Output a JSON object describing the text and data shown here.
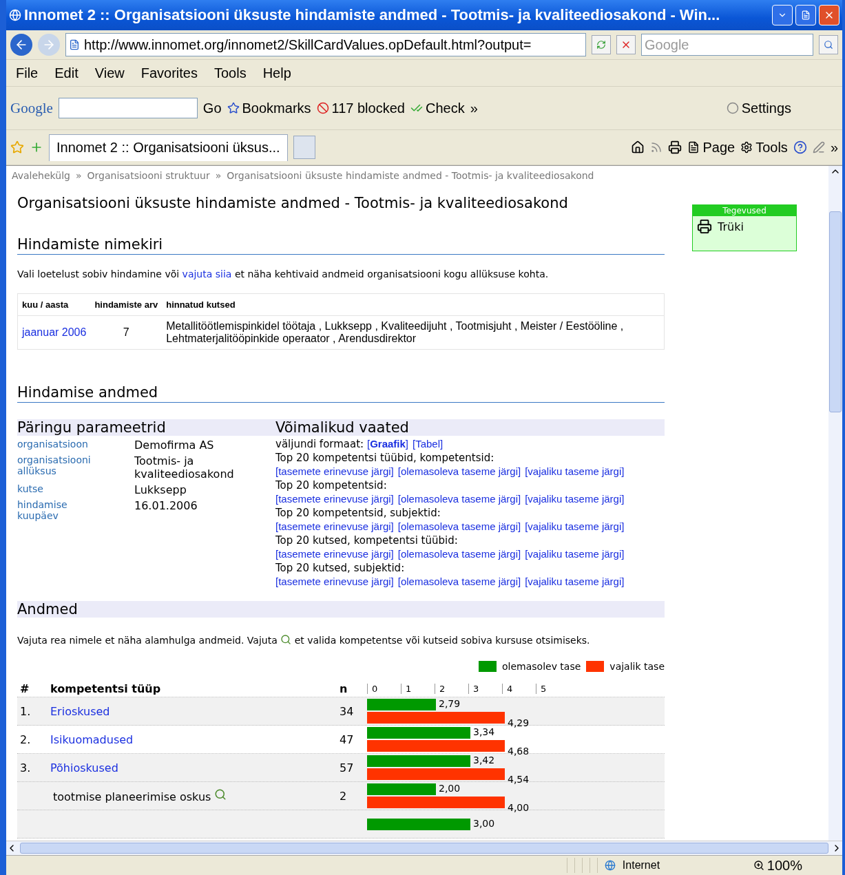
{
  "window": {
    "title": "Innomet 2 :: Organisatsiooni üksuste hindamiste andmed - Tootmis- ja kvaliteediosakond - Win..."
  },
  "address_bar": {
    "url": "http://www.innomet.org/innomet2/SkillCardValues.opDefault.html?output=",
    "search_placeholder": "Google"
  },
  "menu": [
    "File",
    "Edit",
    "View",
    "Favorites",
    "Tools",
    "Help"
  ],
  "google_toolbar": {
    "logo": "Google",
    "go": "Go",
    "bookmarks": "Bookmarks",
    "blocked": "117 blocked",
    "check": "Check",
    "more": "»",
    "settings": "Settings"
  },
  "tabs": [
    {
      "label": "Innomet 2 :: Organisatsiooni üksus...",
      "selected": true
    }
  ],
  "command_bar": {
    "page": "Page",
    "tools": "Tools",
    "more": "»"
  },
  "breadcrumb": {
    "separator": "»",
    "items": [
      "Avalehekülg",
      "Organisatsiooni struktuur",
      "Organisatsiooni üksuste hindamiste andmed - Tootmis- ja kvaliteediosakond"
    ]
  },
  "heading": "Organisatsiooni üksuste hindamiste andmed - Tootmis- ja kvaliteediosakond",
  "actions": {
    "title": "Tegevused",
    "items": [
      "Trüki"
    ]
  },
  "list_section": {
    "title": "Hindamiste nimekiri",
    "intro_before": "Vali loetelust sobiv hindamine või",
    "intro_link": "vajuta siia",
    "intro_after": "et näha kehtivaid andmeid organisatsiooni kogu allüksuse kohta.",
    "columns": [
      "kuu / aasta",
      "hindamiste arv",
      "hinnatud kutsed"
    ],
    "rows": [
      {
        "period": "jaanuar 2006",
        "count": "7",
        "professions": "Metallitöötlemispinkidel töötaja , Lukksepp , Kvaliteedijuht , Tootmisjuht , Meister / Eestööline , Lehtmaterjalitööpinkide operaator , Arendusdirektor"
      }
    ]
  },
  "data_section": {
    "title": "Hindamise andmed",
    "params": {
      "title": "Päringu parameetrid",
      "rows": [
        {
          "label": "organisatsioon",
          "value": "Demofirma AS"
        },
        {
          "label": "organisatsiooni allüksus",
          "value": "Tootmis- ja kvaliteediosakond"
        },
        {
          "label": "kutse",
          "value": "Lukksepp"
        },
        {
          "label": "hindamise kuupäev",
          "value": "16.01.2006"
        }
      ]
    },
    "views": {
      "title": "Võimalikud vaated",
      "format_label": "väljundi formaat:",
      "formats": [
        "[**Graafik**]",
        "[Tabel]"
      ],
      "groups": [
        {
          "title": "Top 20 kompetentsi tüübid, kompetentsid:",
          "links": [
            "[tasemete erinevuse järgi]",
            "[olemasoleva taseme järgi]",
            "[vajaliku taseme järgi]"
          ]
        },
        {
          "title": "Top 20 kompetentsid:",
          "links": [
            "[tasemete erinevuse järgi]",
            "[olemasoleva taseme järgi]",
            "[vajaliku taseme järgi]"
          ]
        },
        {
          "title": "Top 20 kompetentsid, subjektid:",
          "links": [
            "[tasemete erinevuse järgi]",
            "[olemasoleva taseme järgi]",
            "[vajaliku taseme järgi]"
          ]
        },
        {
          "title": "Top 20 kutsed, kompetentsi tüübid:",
          "links": [
            "[tasemete erinevuse järgi]",
            "[olemasoleva taseme järgi]",
            "[vajaliku taseme järgi]"
          ]
        },
        {
          "title": "Top 20 kutsed, subjektid:",
          "links": [
            "[tasemete erinevuse järgi]",
            "[olemasoleva taseme järgi]",
            "[vajaliku taseme järgi]"
          ]
        }
      ]
    }
  },
  "results": {
    "title": "Andmed",
    "hint_before": "Vajuta rea nimele et näha alamhulga andmeid. Vajuta",
    "hint_after": "et valida kompetentse või kutseid sobiva kursuse otsimiseks.",
    "legend": [
      {
        "label": "olemasolev tase",
        "color": "#009900"
      },
      {
        "label": "vajalik tase",
        "color": "#ff3300"
      }
    ],
    "columns": [
      "#",
      "kompetentsi tüüp",
      "n"
    ],
    "scale": [
      "0",
      "1",
      "2",
      "3",
      "4",
      "5"
    ],
    "rows": [
      {
        "kind": "group",
        "shaded": true,
        "number": "1.",
        "name": "Erioskused",
        "n": "34",
        "bars": [
          {
            "kind": "current",
            "label": "2,79"
          },
          {
            "kind": "required",
            "label": "4,29"
          }
        ]
      },
      {
        "kind": "group",
        "shaded": false,
        "number": "2.",
        "name": "Isikuomadused",
        "n": "47",
        "bars": [
          {
            "kind": "current",
            "label": "3,34"
          },
          {
            "kind": "required",
            "label": "4,68"
          }
        ]
      },
      {
        "kind": "group",
        "shaded": true,
        "number": "3.",
        "name": "Põhioskused",
        "n": "57",
        "bars": [
          {
            "kind": "current",
            "label": "3,42"
          },
          {
            "kind": "required",
            "label": "4,54"
          }
        ]
      },
      {
        "kind": "item",
        "shaded": true,
        "name": "tootmise planeerimise oskus",
        "n": "2",
        "bars": [
          {
            "kind": "current",
            "label": "2,00"
          },
          {
            "kind": "required",
            "label": "4,00"
          }
        ]
      },
      {
        "kind": "item",
        "shaded": true,
        "bars": [
          {
            "kind": "current",
            "label": "3,00"
          }
        ]
      }
    ]
  },
  "status_bar": {
    "zone": "Internet",
    "zoom": "100%"
  }
}
